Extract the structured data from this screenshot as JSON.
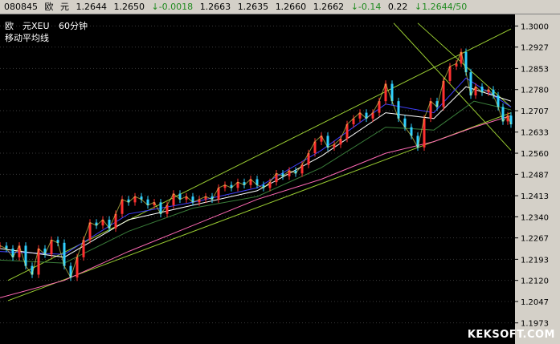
{
  "quote_bar": {
    "code": "080845",
    "name_1": "欧",
    "name_2": "元",
    "open": "1.2644",
    "high": "1.2650",
    "change": "↓-0.0018",
    "low": "1.2663",
    "close": "1.2635",
    "v1": "1.2660",
    "v2": "1.2662",
    "pct": "↓-0.14",
    "vol": "0.22",
    "bidask": "↓1.2644/50"
  },
  "chart_labels": {
    "symbol": "欧　元XEU",
    "period": "60分钟",
    "indicator": "移动平均线"
  },
  "watermark": "KEKSOFT.COM",
  "colors": {
    "background": "#000000",
    "axis_panel": "#d4d0c8",
    "channel_lines": "#9acd32",
    "ma_short": "#ffffff",
    "ma_mid1": "#4040ff",
    "ma_mid2": "#ff40ff",
    "ma_long": "#3a7d3a",
    "ma_vlong": "#ff69b4",
    "candles_up": "#ff3030",
    "candles_down": "#30d0ff"
  },
  "chart_data": {
    "type": "line",
    "title": "欧　元XEU 60分钟",
    "subtitle": "移动平均线",
    "xlabel": "",
    "ylabel": "",
    "ylim": [
      1.19,
      1.304
    ],
    "y_ticks": [
      "1.3000",
      "1.2927",
      "1.2853",
      "1.2780",
      "1.2707",
      "1.2633",
      "1.2560",
      "1.2487",
      "1.2413",
      "1.2340",
      "1.2267",
      "1.2193",
      "1.2120",
      "1.2047",
      "1.1973"
    ],
    "grid": true,
    "price_series": [
      [
        0,
        1.224
      ],
      [
        8,
        1.223
      ],
      [
        16,
        1.22
      ],
      [
        24,
        1.224
      ],
      [
        32,
        1.217
      ],
      [
        40,
        1.214
      ],
      [
        48,
        1.223
      ],
      [
        56,
        1.221
      ],
      [
        64,
        1.226
      ],
      [
        72,
        1.225
      ],
      [
        80,
        1.217
      ],
      [
        88,
        1.213
      ],
      [
        96,
        1.22
      ],
      [
        104,
        1.226
      ],
      [
        112,
        1.232
      ],
      [
        120,
        1.231
      ],
      [
        128,
        1.233
      ],
      [
        136,
        1.23
      ],
      [
        144,
        1.235
      ],
      [
        152,
        1.24
      ],
      [
        160,
        1.239
      ],
      [
        168,
        1.241
      ],
      [
        176,
        1.24
      ],
      [
        184,
        1.238
      ],
      [
        192,
        1.239
      ],
      [
        200,
        1.235
      ],
      [
        208,
        1.238
      ],
      [
        216,
        1.242
      ],
      [
        224,
        1.24
      ],
      [
        232,
        1.241
      ],
      [
        240,
        1.239
      ],
      [
        248,
        1.24
      ],
      [
        256,
        1.241
      ],
      [
        264,
        1.24
      ],
      [
        272,
        1.244
      ],
      [
        280,
        1.245
      ],
      [
        288,
        1.244
      ],
      [
        296,
        1.246
      ],
      [
        304,
        1.245
      ],
      [
        312,
        1.247
      ],
      [
        320,
        1.245
      ],
      [
        328,
        1.244
      ],
      [
        336,
        1.246
      ],
      [
        344,
        1.249
      ],
      [
        352,
        1.248
      ],
      [
        360,
        1.25
      ],
      [
        368,
        1.249
      ],
      [
        376,
        1.252
      ],
      [
        384,
        1.256
      ],
      [
        392,
        1.26
      ],
      [
        400,
        1.262
      ],
      [
        408,
        1.258
      ],
      [
        416,
        1.259
      ],
      [
        424,
        1.261
      ],
      [
        432,
        1.266
      ],
      [
        440,
        1.268
      ],
      [
        448,
        1.27
      ],
      [
        456,
        1.268
      ],
      [
        464,
        1.27
      ],
      [
        472,
        1.274
      ],
      [
        480,
        1.28
      ],
      [
        488,
        1.274
      ],
      [
        496,
        1.268
      ],
      [
        504,
        1.265
      ],
      [
        512,
        1.262
      ],
      [
        520,
        1.258
      ],
      [
        528,
        1.268
      ],
      [
        536,
        1.274
      ],
      [
        544,
        1.272
      ],
      [
        552,
        1.281
      ],
      [
        560,
        1.286
      ],
      [
        568,
        1.287
      ],
      [
        574,
        1.291
      ],
      [
        580,
        1.284
      ],
      [
        586,
        1.276
      ],
      [
        592,
        1.279
      ],
      [
        600,
        1.277
      ],
      [
        608,
        1.278
      ],
      [
        614,
        1.276
      ],
      [
        620,
        1.272
      ],
      [
        626,
        1.267
      ],
      [
        632,
        1.269
      ],
      [
        636,
        1.266
      ]
    ],
    "series": [
      {
        "values": [
          [
            0,
            1.222
          ],
          [
            80,
            1.221
          ],
          [
            160,
            1.235
          ],
          [
            240,
            1.239
          ],
          [
            320,
            1.244
          ],
          [
            400,
            1.257
          ],
          [
            480,
            1.273
          ],
          [
            540,
            1.27
          ],
          [
            580,
            1.282
          ],
          [
            636,
            1.272
          ]
        ]
      },
      {
        "values": [
          [
            0,
            1.223
          ],
          [
            80,
            1.22
          ],
          [
            160,
            1.233
          ],
          [
            240,
            1.238
          ],
          [
            320,
            1.243
          ],
          [
            400,
            1.255
          ],
          [
            480,
            1.27
          ],
          [
            540,
            1.268
          ],
          [
            580,
            1.279
          ],
          [
            636,
            1.274
          ]
        ]
      },
      {
        "values": [
          [
            0,
            1.219
          ],
          [
            80,
            1.218
          ],
          [
            160,
            1.229
          ],
          [
            240,
            1.237
          ],
          [
            320,
            1.241
          ],
          [
            400,
            1.251
          ],
          [
            480,
            1.265
          ],
          [
            540,
            1.264
          ],
          [
            590,
            1.274
          ],
          [
            636,
            1.271
          ]
        ]
      },
      {
        "values": [
          [
            0,
            1.206
          ],
          [
            80,
            1.212
          ],
          [
            160,
            1.222
          ],
          [
            240,
            1.231
          ],
          [
            320,
            1.24
          ],
          [
            400,
            1.247
          ],
          [
            480,
            1.256
          ],
          [
            540,
            1.26
          ],
          [
            590,
            1.265
          ],
          [
            636,
            1.269
          ]
        ]
      }
    ],
    "channel": {
      "upper": [
        [
          10,
          1.212
        ],
        [
          636,
          1.299
        ]
      ],
      "lower": [
        [
          10,
          1.205
        ],
        [
          636,
          1.27
        ]
      ],
      "fan_1": [
        [
          490,
          1.301
        ],
        [
          636,
          1.257
        ]
      ],
      "fan_2": [
        [
          520,
          1.301
        ],
        [
          636,
          1.272
        ]
      ]
    }
  }
}
